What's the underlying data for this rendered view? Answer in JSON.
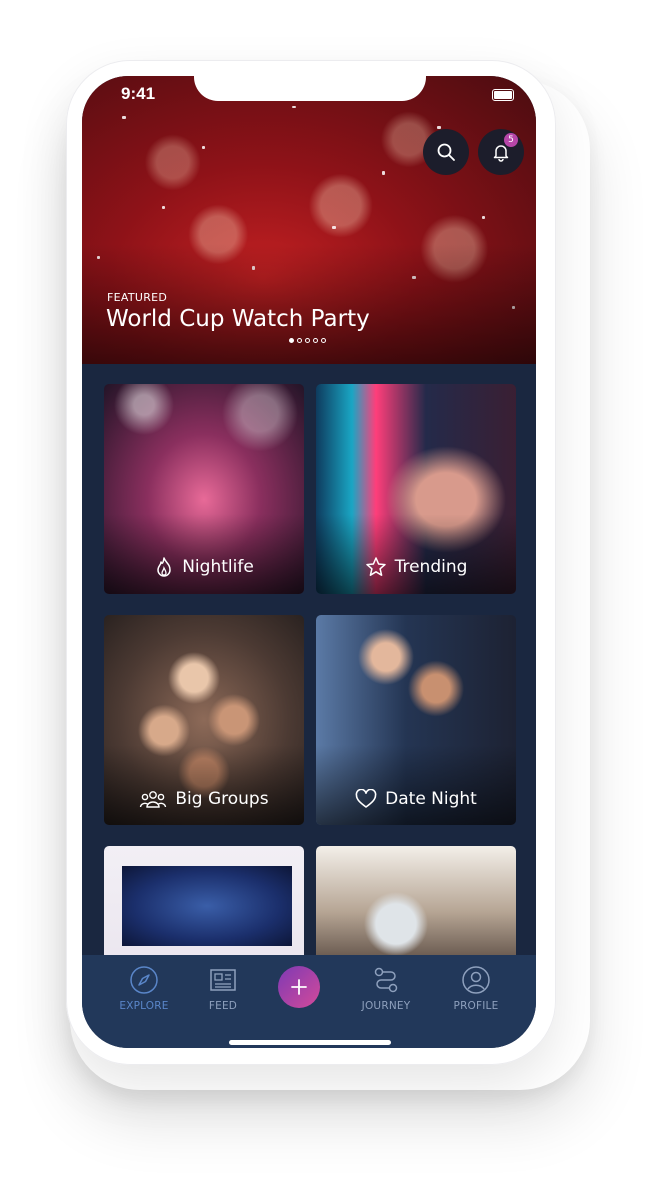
{
  "status": {
    "time": "9:41"
  },
  "header": {
    "notifications_count": "5"
  },
  "featured": {
    "label": "FEATURED",
    "title": "World Cup Watch Party",
    "slides": 5,
    "active_slide": 1
  },
  "categories": [
    {
      "label": "Nightlife",
      "icon": "flame-icon"
    },
    {
      "label": "Trending",
      "icon": "star-icon"
    },
    {
      "label": "Big Groups",
      "icon": "group-icon"
    },
    {
      "label": "Date Night",
      "icon": "heart-icon"
    }
  ],
  "tabbar": {
    "explore": "EXPLORE",
    "feed": "FEED",
    "journey": "JOURNEY",
    "profile": "PROFILE",
    "active": "explore"
  },
  "colors": {
    "background": "#1a2740",
    "tabbar": "#22385a",
    "accent_active": "#5a86c9",
    "plus_gradient_start": "#7d3ab4",
    "plus_gradient_end": "#d44a9a",
    "badge": "#b646a8"
  }
}
